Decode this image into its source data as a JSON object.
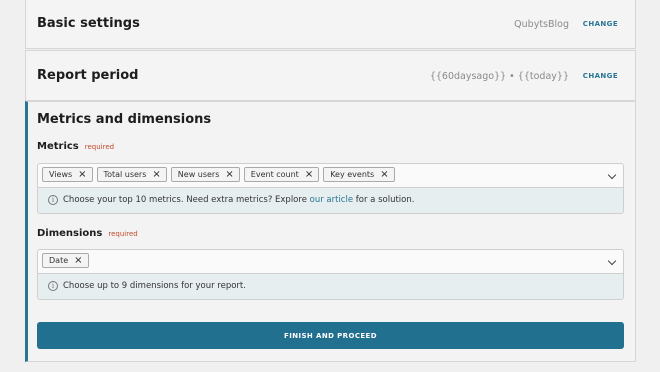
{
  "basic_settings": {
    "title": "Basic settings",
    "value": "QubytsBlog",
    "change_label": "CHANGE"
  },
  "report_period": {
    "title": "Report period",
    "value": "{{60daysago}} • {{today}}",
    "change_label": "CHANGE"
  },
  "metrics_section": {
    "title": "Metrics and dimensions",
    "metrics": {
      "label": "Metrics",
      "required": "required",
      "chips": [
        "Views",
        "Total users",
        "New users",
        "Event count",
        "Key events"
      ],
      "hint_prefix": "Choose your top 10 metrics. Need extra metrics? Explore ",
      "hint_link": "our article",
      "hint_suffix": " for a solution."
    },
    "dimensions": {
      "label": "Dimensions",
      "required": "required",
      "chips": [
        "Date"
      ],
      "hint": "Choose up to 9 dimensions for your report."
    },
    "finish_label": "FINISH AND PROCEED"
  },
  "colors": {
    "accent": "#21708f",
    "required": "#c24a2e",
    "hint_bg": "#e6eef0"
  },
  "icons": {
    "remove": "close-icon",
    "dropdown": "chevron-down-icon",
    "info": "info-icon"
  }
}
